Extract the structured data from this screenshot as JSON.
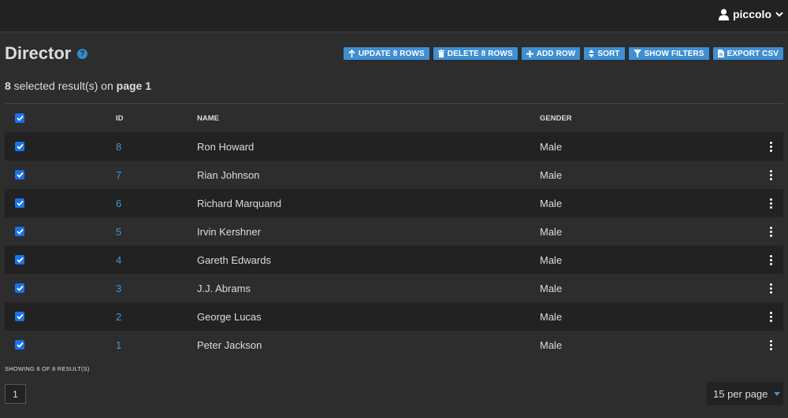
{
  "user": {
    "name": "piccolo",
    "icon": "user-icon",
    "chevron": "chevron-down-icon"
  },
  "page": {
    "title": "Director",
    "help_icon": "?"
  },
  "toolbar": {
    "update_label": "UPDATE 8 ROWS",
    "delete_label": "DELETE 8 ROWS",
    "add_label": "ADD ROW",
    "sort_label": "SORT",
    "filters_label": "SHOW FILTERS",
    "export_label": "EXPORT CSV",
    "accent_color": "#3e8fd3"
  },
  "selection": {
    "count": "8",
    "middle": " selected result(s) on ",
    "page_label": "page 1"
  },
  "table": {
    "columns": {
      "id": "ID",
      "name": "NAME",
      "gender": "GENDER"
    },
    "rows": [
      {
        "id": "8",
        "name": "Ron Howard",
        "gender": "Male",
        "checked": true
      },
      {
        "id": "7",
        "name": "Rian Johnson",
        "gender": "Male",
        "checked": true
      },
      {
        "id": "6",
        "name": "Richard Marquand",
        "gender": "Male",
        "checked": true
      },
      {
        "id": "5",
        "name": "Irvin Kershner",
        "gender": "Male",
        "checked": true
      },
      {
        "id": "4",
        "name": "Gareth Edwards",
        "gender": "Male",
        "checked": true
      },
      {
        "id": "3",
        "name": "J.J. Abrams",
        "gender": "Male",
        "checked": true
      },
      {
        "id": "2",
        "name": "George Lucas",
        "gender": "Male",
        "checked": true
      },
      {
        "id": "1",
        "name": "Peter Jackson",
        "gender": "Male",
        "checked": true
      }
    ]
  },
  "footer": {
    "showing": "SHOWING 8 OF 8 RESULT(S)",
    "current_page": "1",
    "per_page": "15 per page"
  }
}
